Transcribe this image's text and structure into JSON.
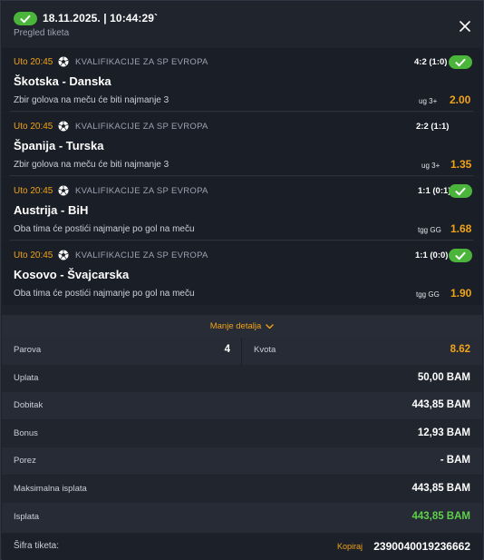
{
  "header": {
    "title": "18.11.2025. | 10:44:29`",
    "subtitle": "Pregled tiketa"
  },
  "matches": [
    {
      "time": "Uto 20:45",
      "competition": "KVALIFIKACIJE ZA SP EVROPA",
      "teams": "Škotska - Danska",
      "bet": "Zbir golova na meču će biti najmanje 3",
      "score": "4:2 (1:0)",
      "tip": "ug 3+",
      "odd": "2.00",
      "won": true
    },
    {
      "time": "Uto 20:45",
      "competition": "KVALIFIKACIJE ZA SP EVROPA",
      "teams": "Španija - Turska",
      "bet": "Zbir golova na meču će biti najmanje 3",
      "score": "2:2 (1:1)",
      "tip": "ug 3+",
      "odd": "1.35",
      "won": true
    },
    {
      "time": "Uto 20:45",
      "competition": "KVALIFIKACIJE ZA SP EVROPA",
      "teams": "Austrija - BiH",
      "bet": "Oba tima će postići najmanje po gol na meču",
      "score": "1:1 (0:1)",
      "tip": "tgg GG",
      "odd": "1.68",
      "won": true
    },
    {
      "time": "Uto 20:45",
      "competition": "KVALIFIKACIJE ZA SP EVROPA",
      "teams": "Kosovo - Švajcarska",
      "bet": "Oba tima će postići najmanje po gol na meču",
      "score": "1:1 (0:0)",
      "tip": "tgg GG",
      "odd": "1.90",
      "won": true
    }
  ],
  "details_toggle": "Manje detalja",
  "summary": {
    "parova_label": "Parova",
    "parova_value": "4",
    "kvota_label": "Kvota",
    "kvota_value": "8.62",
    "uplata_label": "Uplata",
    "uplata_value": "50,00 BAM",
    "dobitak_label": "Dobitak",
    "dobitak_value": "443,85 BAM",
    "bonus_label": "Bonus",
    "bonus_value": "12,93 BAM",
    "porez_label": "Porez",
    "porez_value": "- BAM",
    "max_label": "Maksimalna isplata",
    "max_value": "443,85 BAM",
    "isplata_label": "Isplata",
    "isplata_value": "443,85 BAM"
  },
  "footer": {
    "label": "Šifra tiketa:",
    "copy": "Kopiraj",
    "code": "2390040019236662"
  },
  "colors": {
    "accent": "#f0a319",
    "win": "#4bb53b",
    "win_text": "#5fd04a"
  },
  "icons": [
    "check-icon",
    "close-icon",
    "football-icon",
    "chevron-down-icon"
  ]
}
